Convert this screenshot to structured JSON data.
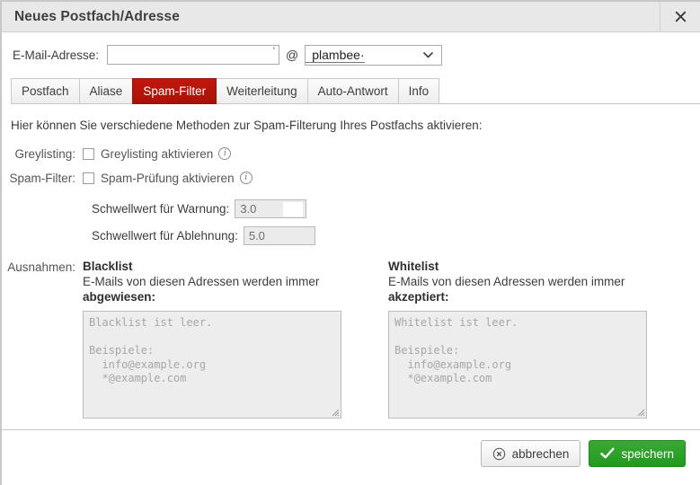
{
  "window": {
    "title": "Neues Postfach/Adresse",
    "close_icon": "close-icon",
    "close_glyph": "✕"
  },
  "address": {
    "label": "E-Mail-Adresse:",
    "input_value": "",
    "input_tick": "'",
    "at_symbol": "@",
    "domain_selected": "plambee·",
    "domain_options": [
      "plambee·"
    ],
    "dropdown_icon": "chevron-down-icon"
  },
  "tabs": [
    {
      "label": "Postfach",
      "active": false
    },
    {
      "label": "Aliase",
      "active": false
    },
    {
      "label": "Spam-Filter",
      "active": true
    },
    {
      "label": "Weiterleitung",
      "active": false
    },
    {
      "label": "Auto-Antwort",
      "active": false
    },
    {
      "label": "Info",
      "active": false
    }
  ],
  "panel": {
    "intro": "Hier können Sie verschiedene Methoden zur Spam-Filterung Ihres Postfachs aktivieren:",
    "greylisting": {
      "label": "Greylisting:",
      "checkbox_text": "Greylisting aktivieren",
      "checked": false,
      "info_glyph": "i"
    },
    "spamfilter": {
      "label": "Spam-Filter:",
      "checkbox_text": "Spam-Prüfung aktivieren",
      "checked": false,
      "info_glyph": "i"
    },
    "threshold_warning": {
      "label": "Schwellwert für Warnung:",
      "value": "3.0"
    },
    "threshold_reject": {
      "label": "Schwellwert für Ablehnung:",
      "value": "5.0"
    },
    "exceptions": {
      "label": "Ausnahmen:",
      "blacklist": {
        "title": "Blacklist",
        "desc_plain": "E-Mails von diesen Adressen werden immer",
        "desc_bold": "abgewiesen:",
        "textarea_value": "",
        "textarea_placeholder": "Blacklist ist leer.\n\nBeispiele:\n  info@example.org\n  *@example.com"
      },
      "whitelist": {
        "title": "Whitelist",
        "desc_plain": "E-Mails von diesen Adressen werden immer",
        "desc_bold": "akzeptiert:",
        "textarea_value": "",
        "textarea_placeholder": "Whitelist ist leer.\n\nBeispiele:\n  info@example.org\n  *@example.com"
      }
    }
  },
  "footer": {
    "cancel_label": "abbrechen",
    "cancel_icon": "cancel-circle-icon",
    "save_label": "speichern",
    "save_icon": "check-icon"
  },
  "colors": {
    "accent_tab": "#b71c12",
    "save_green": "#2ba028",
    "titlebar_bg": "#e8e8e8",
    "field_disabled_bg": "#ebebeb"
  }
}
